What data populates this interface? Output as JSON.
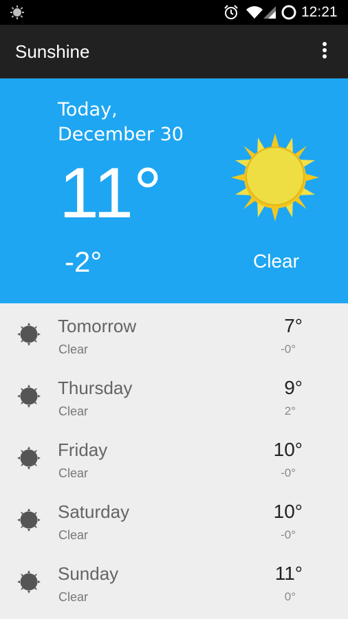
{
  "status_bar": {
    "time": "12:21",
    "icons": [
      "weather-sun-icon",
      "alarm-clock-icon",
      "wifi-icon",
      "cell-signal-icon",
      "battery-circle-icon"
    ]
  },
  "toolbar": {
    "title": "Sunshine",
    "overflow_icon": "more-vert-icon"
  },
  "today": {
    "date": "Today, December 30",
    "high": "11°",
    "low": "-2°",
    "condition": "Clear",
    "icon": "sun-icon"
  },
  "colors": {
    "accent": "#1ea6f2",
    "toolbar": "#212121",
    "list_bg": "#eeeeee",
    "sun_yellow": "#f2e33a",
    "sun_orange": "#f2c51f"
  },
  "forecast": [
    {
      "day": "Tomorrow",
      "condition": "Clear",
      "high": "7°",
      "low": "-0°",
      "icon": "clear-icon"
    },
    {
      "day": "Thursday",
      "condition": "Clear",
      "high": "9°",
      "low": "2°",
      "icon": "clear-icon"
    },
    {
      "day": "Friday",
      "condition": "Clear",
      "high": "10°",
      "low": "-0°",
      "icon": "clear-icon"
    },
    {
      "day": "Saturday",
      "condition": "Clear",
      "high": "10°",
      "low": "-0°",
      "icon": "clear-icon"
    },
    {
      "day": "Sunday",
      "condition": "Clear",
      "high": "11°",
      "low": "0°",
      "icon": "clear-icon"
    }
  ]
}
